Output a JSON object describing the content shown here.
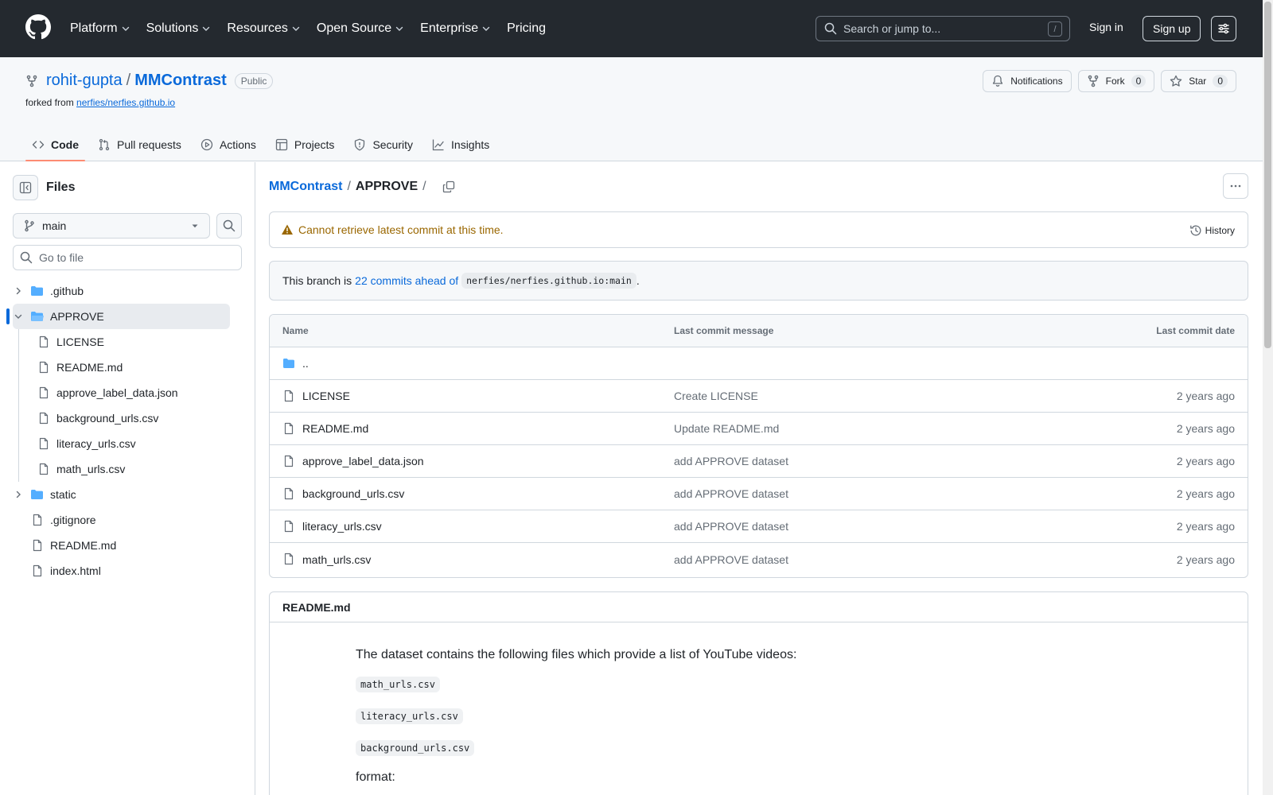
{
  "header": {
    "nav": [
      {
        "label": "Platform",
        "has_menu": true
      },
      {
        "label": "Solutions",
        "has_menu": true
      },
      {
        "label": "Resources",
        "has_menu": true
      },
      {
        "label": "Open Source",
        "has_menu": true
      },
      {
        "label": "Enterprise",
        "has_menu": true
      },
      {
        "label": "Pricing",
        "has_menu": false
      }
    ],
    "search_placeholder": "Search or jump to...",
    "search_shortcut": "/",
    "sign_in": "Sign in",
    "sign_up": "Sign up"
  },
  "repo": {
    "owner": "rohit-gupta",
    "separator": "/",
    "name": "MMContrast",
    "visibility": "Public",
    "forked_prefix": "forked from",
    "forked_from": "nerfies/nerfies.github.io",
    "actions": {
      "notifications": "Notifications",
      "fork": "Fork",
      "fork_count": "0",
      "star": "Star",
      "star_count": "0"
    },
    "tabs": [
      {
        "label": "Code",
        "icon": "code-icon",
        "active": true
      },
      {
        "label": "Pull requests",
        "icon": "pull-request-icon",
        "active": false
      },
      {
        "label": "Actions",
        "icon": "play-icon",
        "active": false
      },
      {
        "label": "Projects",
        "icon": "table-icon",
        "active": false
      },
      {
        "label": "Security",
        "icon": "shield-icon",
        "active": false
      },
      {
        "label": "Insights",
        "icon": "graph-icon",
        "active": false
      }
    ]
  },
  "sidebar": {
    "title": "Files",
    "branch": "main",
    "go_to_file": "Go to file",
    "tree": [
      {
        "label": ".github",
        "type": "folder",
        "depth": 0,
        "expanded": false
      },
      {
        "label": "APPROVE",
        "type": "folder",
        "depth": 0,
        "expanded": true,
        "selected": true
      },
      {
        "label": "LICENSE",
        "type": "file",
        "depth": 1
      },
      {
        "label": "README.md",
        "type": "file",
        "depth": 1
      },
      {
        "label": "approve_label_data.json",
        "type": "file",
        "depth": 1
      },
      {
        "label": "background_urls.csv",
        "type": "file",
        "depth": 1
      },
      {
        "label": "literacy_urls.csv",
        "type": "file",
        "depth": 1
      },
      {
        "label": "math_urls.csv",
        "type": "file",
        "depth": 1
      },
      {
        "label": "static",
        "type": "folder",
        "depth": 0,
        "expanded": false
      },
      {
        "label": ".gitignore",
        "type": "file",
        "depth": 0
      },
      {
        "label": "README.md",
        "type": "file",
        "depth": 0
      },
      {
        "label": "index.html",
        "type": "file",
        "depth": 0
      }
    ]
  },
  "main": {
    "breadcrumb": {
      "repo": "MMContrast",
      "sep": "/",
      "dir": "APPROVE",
      "trail": "/"
    },
    "commit_warning": "Cannot retrieve latest commit at this time.",
    "history": "History",
    "branch_info": {
      "prefix": "This branch is",
      "ahead": "22 commits ahead of",
      "upstream": "nerfies/nerfies.github.io:main",
      "suffix": "."
    },
    "table": {
      "headers": [
        "Name",
        "Last commit message",
        "Last commit date"
      ],
      "parent": "..",
      "rows": [
        {
          "name": "LICENSE",
          "message": "Create LICENSE",
          "date": "2 years ago"
        },
        {
          "name": "README.md",
          "message": "Update README.md",
          "date": "2 years ago"
        },
        {
          "name": "approve_label_data.json",
          "message": "add APPROVE dataset",
          "date": "2 years ago"
        },
        {
          "name": "background_urls.csv",
          "message": "add APPROVE dataset",
          "date": "2 years ago"
        },
        {
          "name": "literacy_urls.csv",
          "message": "add APPROVE dataset",
          "date": "2 years ago"
        },
        {
          "name": "math_urls.csv",
          "message": "add APPROVE dataset",
          "date": "2 years ago"
        }
      ]
    },
    "readme": {
      "title": "README.md",
      "intro": "The dataset contains the following files which provide a list of YouTube videos:",
      "files": [
        "math_urls.csv",
        "literacy_urls.csv",
        "background_urls.csv"
      ],
      "format_label": "format:"
    }
  },
  "colors": {
    "header_bg": "#24292f",
    "link": "#0969da",
    "folder": "#54aeff",
    "warning": "#9a6700",
    "active_tab": "#fd8c73"
  }
}
